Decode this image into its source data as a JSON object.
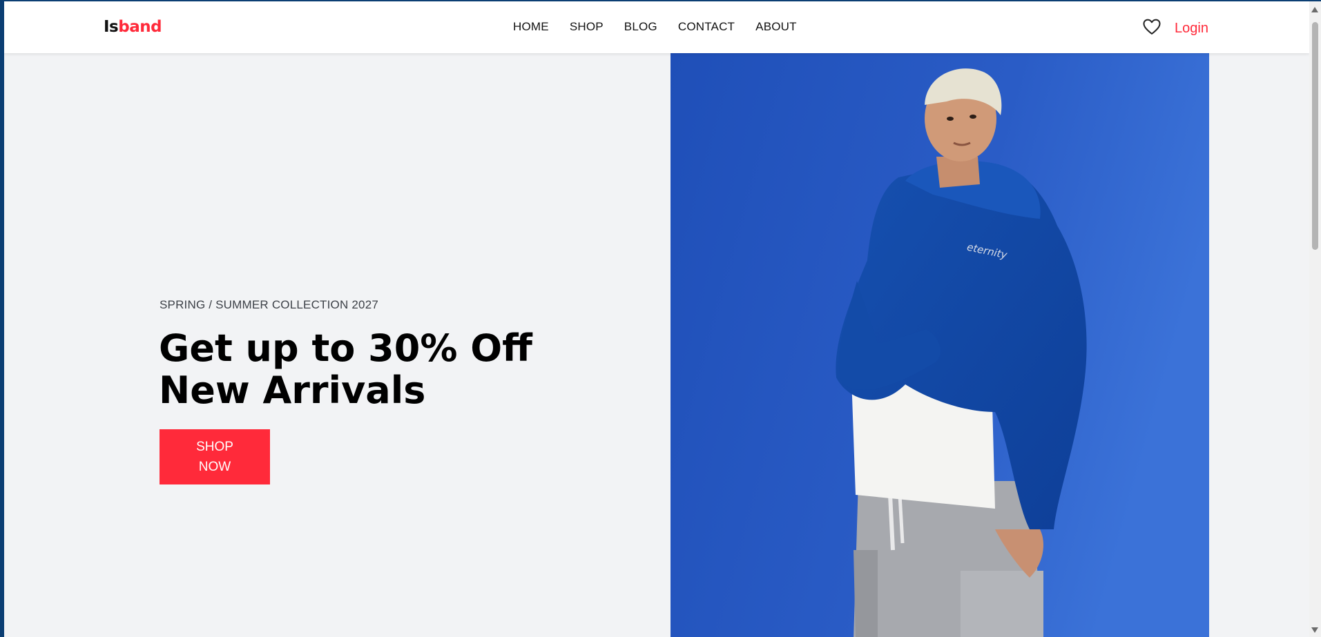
{
  "header": {
    "logo_part1": "Is",
    "logo_part2": "band",
    "nav": [
      "HOME",
      "SHOP",
      "BLOG",
      "CONTACT",
      "ABOUT"
    ],
    "wishlist_icon": "heart-icon",
    "login_label": "Login"
  },
  "hero": {
    "eyebrow": "SPRING / SUMMER COLLECTION 2027",
    "headline_line1": "Get up to 30% Off",
    "headline_line2": "New Arrivals",
    "cta_line1": "SHOP",
    "cta_line2": "NOW",
    "image_print": "eternity"
  },
  "colors": {
    "accent": "#ff2a3a",
    "hero_bg": "#f2f3f5",
    "photo_bg": "#2454c0"
  }
}
